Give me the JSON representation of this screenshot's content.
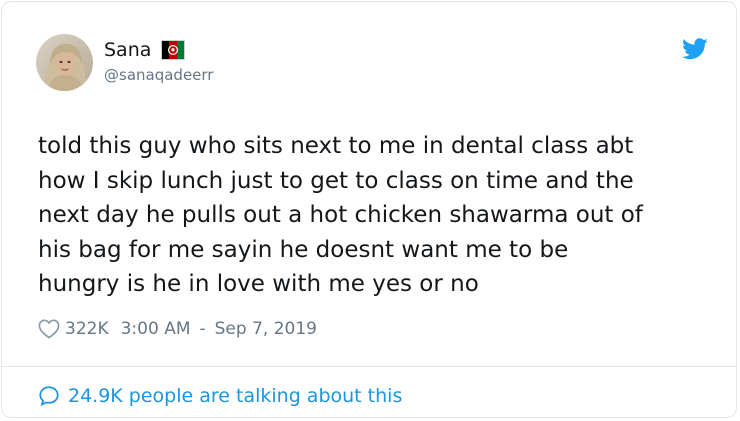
{
  "author": {
    "name": "Sana",
    "handle": "@sanaqadeerr",
    "flag_icon": "afghanistan-flag-icon",
    "avatar_icon": "user-avatar"
  },
  "tweet": {
    "text": "told this guy who sits next to me in dental class abt\nhow I skip lunch just to get to class on time and the\nnext day he pulls out a hot chicken shawarma out of\nhis bag for me sayin he doesnt want me to be\nhungry is he in love with me yes or no",
    "likes": "322K",
    "time": "3:00 AM",
    "separator": "-",
    "date": "Sep 7, 2019"
  },
  "footer": {
    "talking_text": "24.9K people are talking about this"
  },
  "colors": {
    "brand": "#1da1f2",
    "link": "#1b95e0",
    "muted": "#657786",
    "text": "#14171a",
    "border": "#e1e8ed"
  },
  "icons": {
    "logo": "twitter-bird-icon",
    "like": "heart-outline-icon",
    "reply": "speech-bubble-icon"
  }
}
